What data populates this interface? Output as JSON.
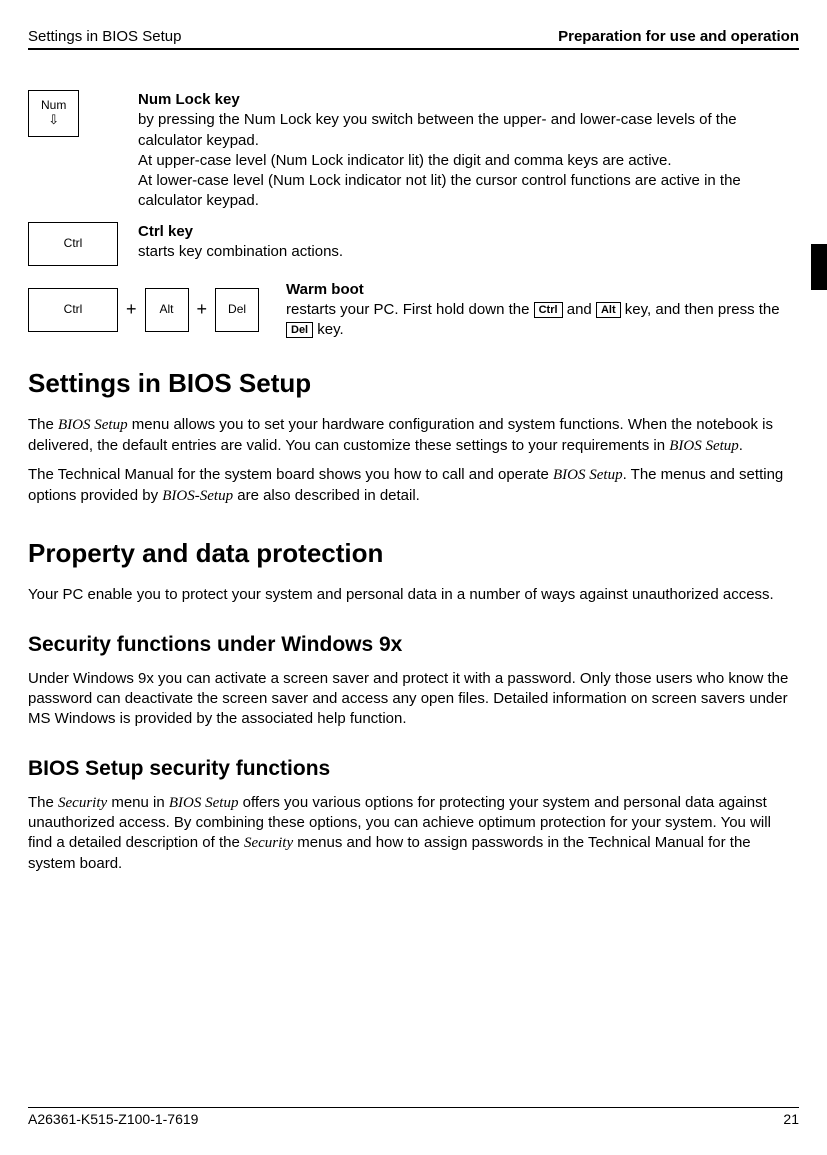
{
  "header": {
    "left": "Settings in BIOS Setup",
    "right": "Preparation for use and operation"
  },
  "numlock": {
    "key": "Num",
    "title": "Num Lock key",
    "l1": "by pressing the Num Lock key you switch between the upper- and lower-case levels of the calculator keypad.",
    "l2": "At upper-case level (Num Lock indicator lit) the digit and comma keys are active.",
    "l3": "At lower-case level (Num Lock indicator not lit) the cursor control functions are active in the calculator keypad."
  },
  "ctrl": {
    "key": "Ctrl",
    "title": "Ctrl key",
    "l1": "starts key combination actions."
  },
  "warm": {
    "k1": "Ctrl",
    "k2": "Alt",
    "k3": "Del",
    "title": "Warm boot",
    "pre": "restarts your PC. First hold down the ",
    "ik1": "Ctrl",
    "mid1": " and ",
    "ik2": "Alt",
    "mid2": " key, and then press the ",
    "ik3": "Del",
    "post": " key."
  },
  "h1a": "Settings in BIOS Setup",
  "p1a": "The ",
  "p1b": "BIOS Setup",
  "p1c": " menu allows you to set your hardware configuration and system functions. When the notebook is delivered, the default entries are valid. You can customize these settings to your requirements in ",
  "p1d": "BIOS Setup",
  "p1e": ".",
  "p2a": "The Technical Manual for the system board shows you how to call and operate ",
  "p2b": "BIOS Setup",
  "p2c": ". The menus and setting options provided by ",
  "p2d": "BIOS-Setup",
  "p2e": " are also described in detail.",
  "h1b": "Property and data protection",
  "p3": "Your PC enable you to protect your system and personal data in a number of ways against unauthorized access.",
  "h2a": "Security functions under Windows 9x",
  "p4": "Under Windows 9x you can activate a screen saver and protect it with a password. Only those users who know the password can deactivate the screen saver and access any open files. Detailed information on screen savers under MS Windows is provided by the associated help function.",
  "h2b": "BIOS Setup security functions",
  "p5a": "The ",
  "p5b": "Security",
  "p5c": " menu in ",
  "p5d": "BIOS Setup",
  "p5e": " offers you various options for protecting your system and personal data against unauthorized access. By combining these options, you can achieve optimum protection for your system. You will find a detailed description of the ",
  "p5f": "Security",
  "p5g": " menus and how to assign passwords in the  Technical Manual for the system board.",
  "footer": {
    "left": "A26361-K515-Z100-1-7619",
    "right": "21"
  }
}
